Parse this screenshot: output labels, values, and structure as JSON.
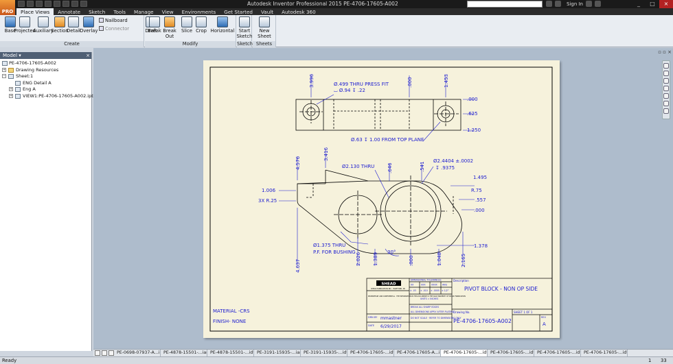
{
  "app": {
    "logo_label": "PRO",
    "window_title": "Autodesk Inventor Professional 2015    PE-4706-17605-A002",
    "search_placeholder": "",
    "sign_in": "Sign In",
    "controls": [
      "_",
      "□",
      "×"
    ]
  },
  "menu_tabs": [
    {
      "label": "Place Views",
      "active": true
    },
    {
      "label": "Annotate"
    },
    {
      "label": "Sketch"
    },
    {
      "label": "Tools"
    },
    {
      "label": "Manage"
    },
    {
      "label": "View"
    },
    {
      "label": "Environments"
    },
    {
      "label": "Get Started"
    },
    {
      "label": "Vault"
    },
    {
      "label": "Autodesk 360"
    }
  ],
  "ribbon": {
    "create": {
      "label": "Create",
      "buttons": [
        "Base",
        "Projected",
        "Auxiliary",
        "Section",
        "Detail",
        "Overlay"
      ],
      "small": [
        "Nailboard",
        "Connector"
      ]
    },
    "modify": {
      "label": "Modify",
      "buttons": [
        "Draft",
        "Break",
        "Break Out",
        "Slice",
        "Crop",
        "Horizontal"
      ]
    },
    "sketch": {
      "label": "Sketch",
      "button_line1": "Start",
      "button_line2": "Sketch"
    },
    "sheets": {
      "label": "Sheets",
      "button": "New Sheet"
    }
  },
  "browser": {
    "title": "Model ▾",
    "close": "×",
    "items": [
      {
        "label": "PE-4706-17605-A002",
        "level": 0,
        "expander": ""
      },
      {
        "label": "Drawing Resources",
        "level": 0,
        "expander": "+"
      },
      {
        "label": "Sheet:1",
        "level": 0,
        "expander": "−"
      },
      {
        "label": "ENG Detail A",
        "level": 1,
        "expander": ""
      },
      {
        "label": "Eng A",
        "level": 1,
        "expander": "+"
      },
      {
        "label": "VIEW1:PE-4706-17605-A002.ipt",
        "level": 1,
        "expander": "+"
      }
    ]
  },
  "drawing": {
    "top_view": {
      "dims": [
        "3.996",
        "Ø.499 THRU PRESS FIT",
        "⌴ Ø.94 ↧ .22",
        ".000",
        "1.453",
        ".000",
        ".625",
        "1.250",
        "Ø.63 ↧ 1.00 FROM TOP PLANE"
      ]
    },
    "front_view": {
      "dims_top": [
        "4.576",
        "3.416",
        "Ø2.130 THRU",
        ".646",
        ".541",
        "Ø2.4404 ±.0002",
        "↧ .9375",
        "1.495",
        "R.75"
      ],
      "dims_left": [
        "1.006",
        "3X R.25"
      ],
      "dims_right": [
        ".557",
        ".000",
        "1.378"
      ],
      "note_1": "Ø1.375 THRU",
      "note_2": "P.F. FOR BUSHING",
      "angle": "30°",
      "dims_bottom": [
        "4.637",
        "2.026",
        "1.389",
        ".000",
        "1.048",
        "2.165"
      ]
    },
    "notes": {
      "material": "MATERIAL -CRS",
      "finish": "FINISH- NONE"
    },
    "title_block": {
      "company": "SHEAD",
      "company_sub": "SHEAD FABRICATION INC · HARTFORD, WI",
      "proprietary": "PROPRIETARY AND CONFIDENTIAL · THE INFORMATION IN THIS DOCUMENT IS THE SOLE PROPERTY OF SHEAD FABRICATION",
      "tolerance_title": "DIMENSIONAL TOLERANCES",
      "tol_header": [
        "XX",
        "XXX",
        "XXXX",
        "ANG"
      ],
      "tol_values": [
        "± .03",
        "± .010",
        "± .0005",
        "± 1/2°"
      ],
      "units": "UNITS = INCHES",
      "break_edges": "BREAK ALL SHARP EDGES",
      "dims_apply": "ALL DIMENSIONS APPLY AFTER PLATING",
      "do_not_scale": "DO NOT SCALE · REFER TO DIMENSIONS ONLY",
      "drawn_by_label": "DRN BY",
      "drawn_by": "mmastner",
      "date_label": "DATE",
      "date": "6/29/2017",
      "description_label": "Description",
      "description": "PIVOT BLOCK - NON OP SIDE",
      "sheet": "SHEET   1  OF  1",
      "drawing_no_label": "Drawing No.",
      "drawing_no": "PE-4706-17605-A002",
      "rev_label": "REV",
      "rev": "A"
    }
  },
  "doc_tabs": [
    {
      "label": "PE-0698-07937-A...ipt"
    },
    {
      "label": "PE-4878-15501-...iam"
    },
    {
      "label": "PE-4878-15501-...idw"
    },
    {
      "label": "PE-3191-15935-...iam"
    },
    {
      "label": "PE-3191-15935-...idw"
    },
    {
      "label": "PE-4706-17605-...idw"
    },
    {
      "label": "PE-4706-17605-A...ipt"
    },
    {
      "label": "PE-4706-17605-...idw",
      "active": true
    },
    {
      "label": "PE-4706-17605-...idw"
    },
    {
      "label": "PE-4706-17605-...idw"
    },
    {
      "label": "PE-4706-17605-...idw"
    }
  ],
  "status": {
    "text": "Ready",
    "value_a": "1",
    "value_b": "33"
  },
  "colors": {
    "dimension": "#1b1bd0",
    "sheet": "#f6f2dc",
    "canvas": "#aebccc",
    "close": "#b32222"
  }
}
